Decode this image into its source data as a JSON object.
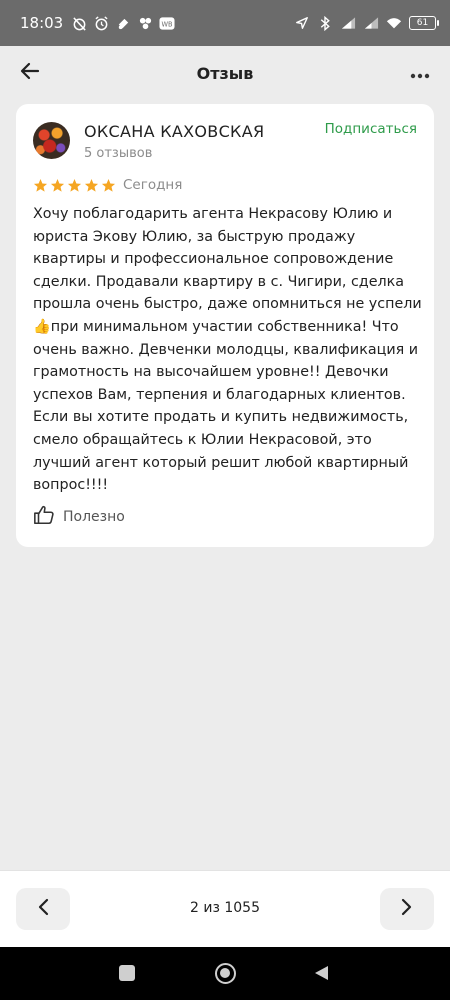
{
  "status_bar": {
    "time": "18:03",
    "battery": "61",
    "icons": [
      "alarm-off-icon",
      "alarm-icon",
      "app-notification-icon",
      "app-notification-icon",
      "wb-icon",
      "location-icon",
      "bluetooth-icon",
      "signal-icon",
      "signal-icon",
      "wifi-icon",
      "battery-icon"
    ]
  },
  "header": {
    "title": "Отзыв",
    "back_icon": "arrow-left-icon",
    "more_icon": "more-horizontal-icon"
  },
  "review": {
    "author_name": "ОКСАНА КАХОВСКАЯ",
    "author_reviews": "5 отзывов",
    "subscribe_label": "Подписаться",
    "rating": 5,
    "date": "Сегодня",
    "text": "Хочу поблагодарить агента Некрасову Юлию и юриста Экову Юлию, за быструю продажу квартиры и профессиональное сопровождение сделки. Продавали квартиру в с. Чигири, сделка прошла очень быстро, даже опомниться не успели 👍при минимальном участии собственника! Что очень важно. Девченки молодцы, квалификация и грамотность на высочайшем уровне!! Девочки успехов Вам, терпения и благодарных клиентов. Если вы хотите продать и купить недвижимость, смело обращайтесь к Юлии Некрасовой, это лучший агент который решит любой квартирный вопрос!!!!",
    "helpful_label": "Полезно"
  },
  "pager": {
    "counter": "2 из 1055"
  },
  "colors": {
    "accent_green": "#2e9b4a",
    "star": "#f5a623",
    "background": "#ececec"
  }
}
